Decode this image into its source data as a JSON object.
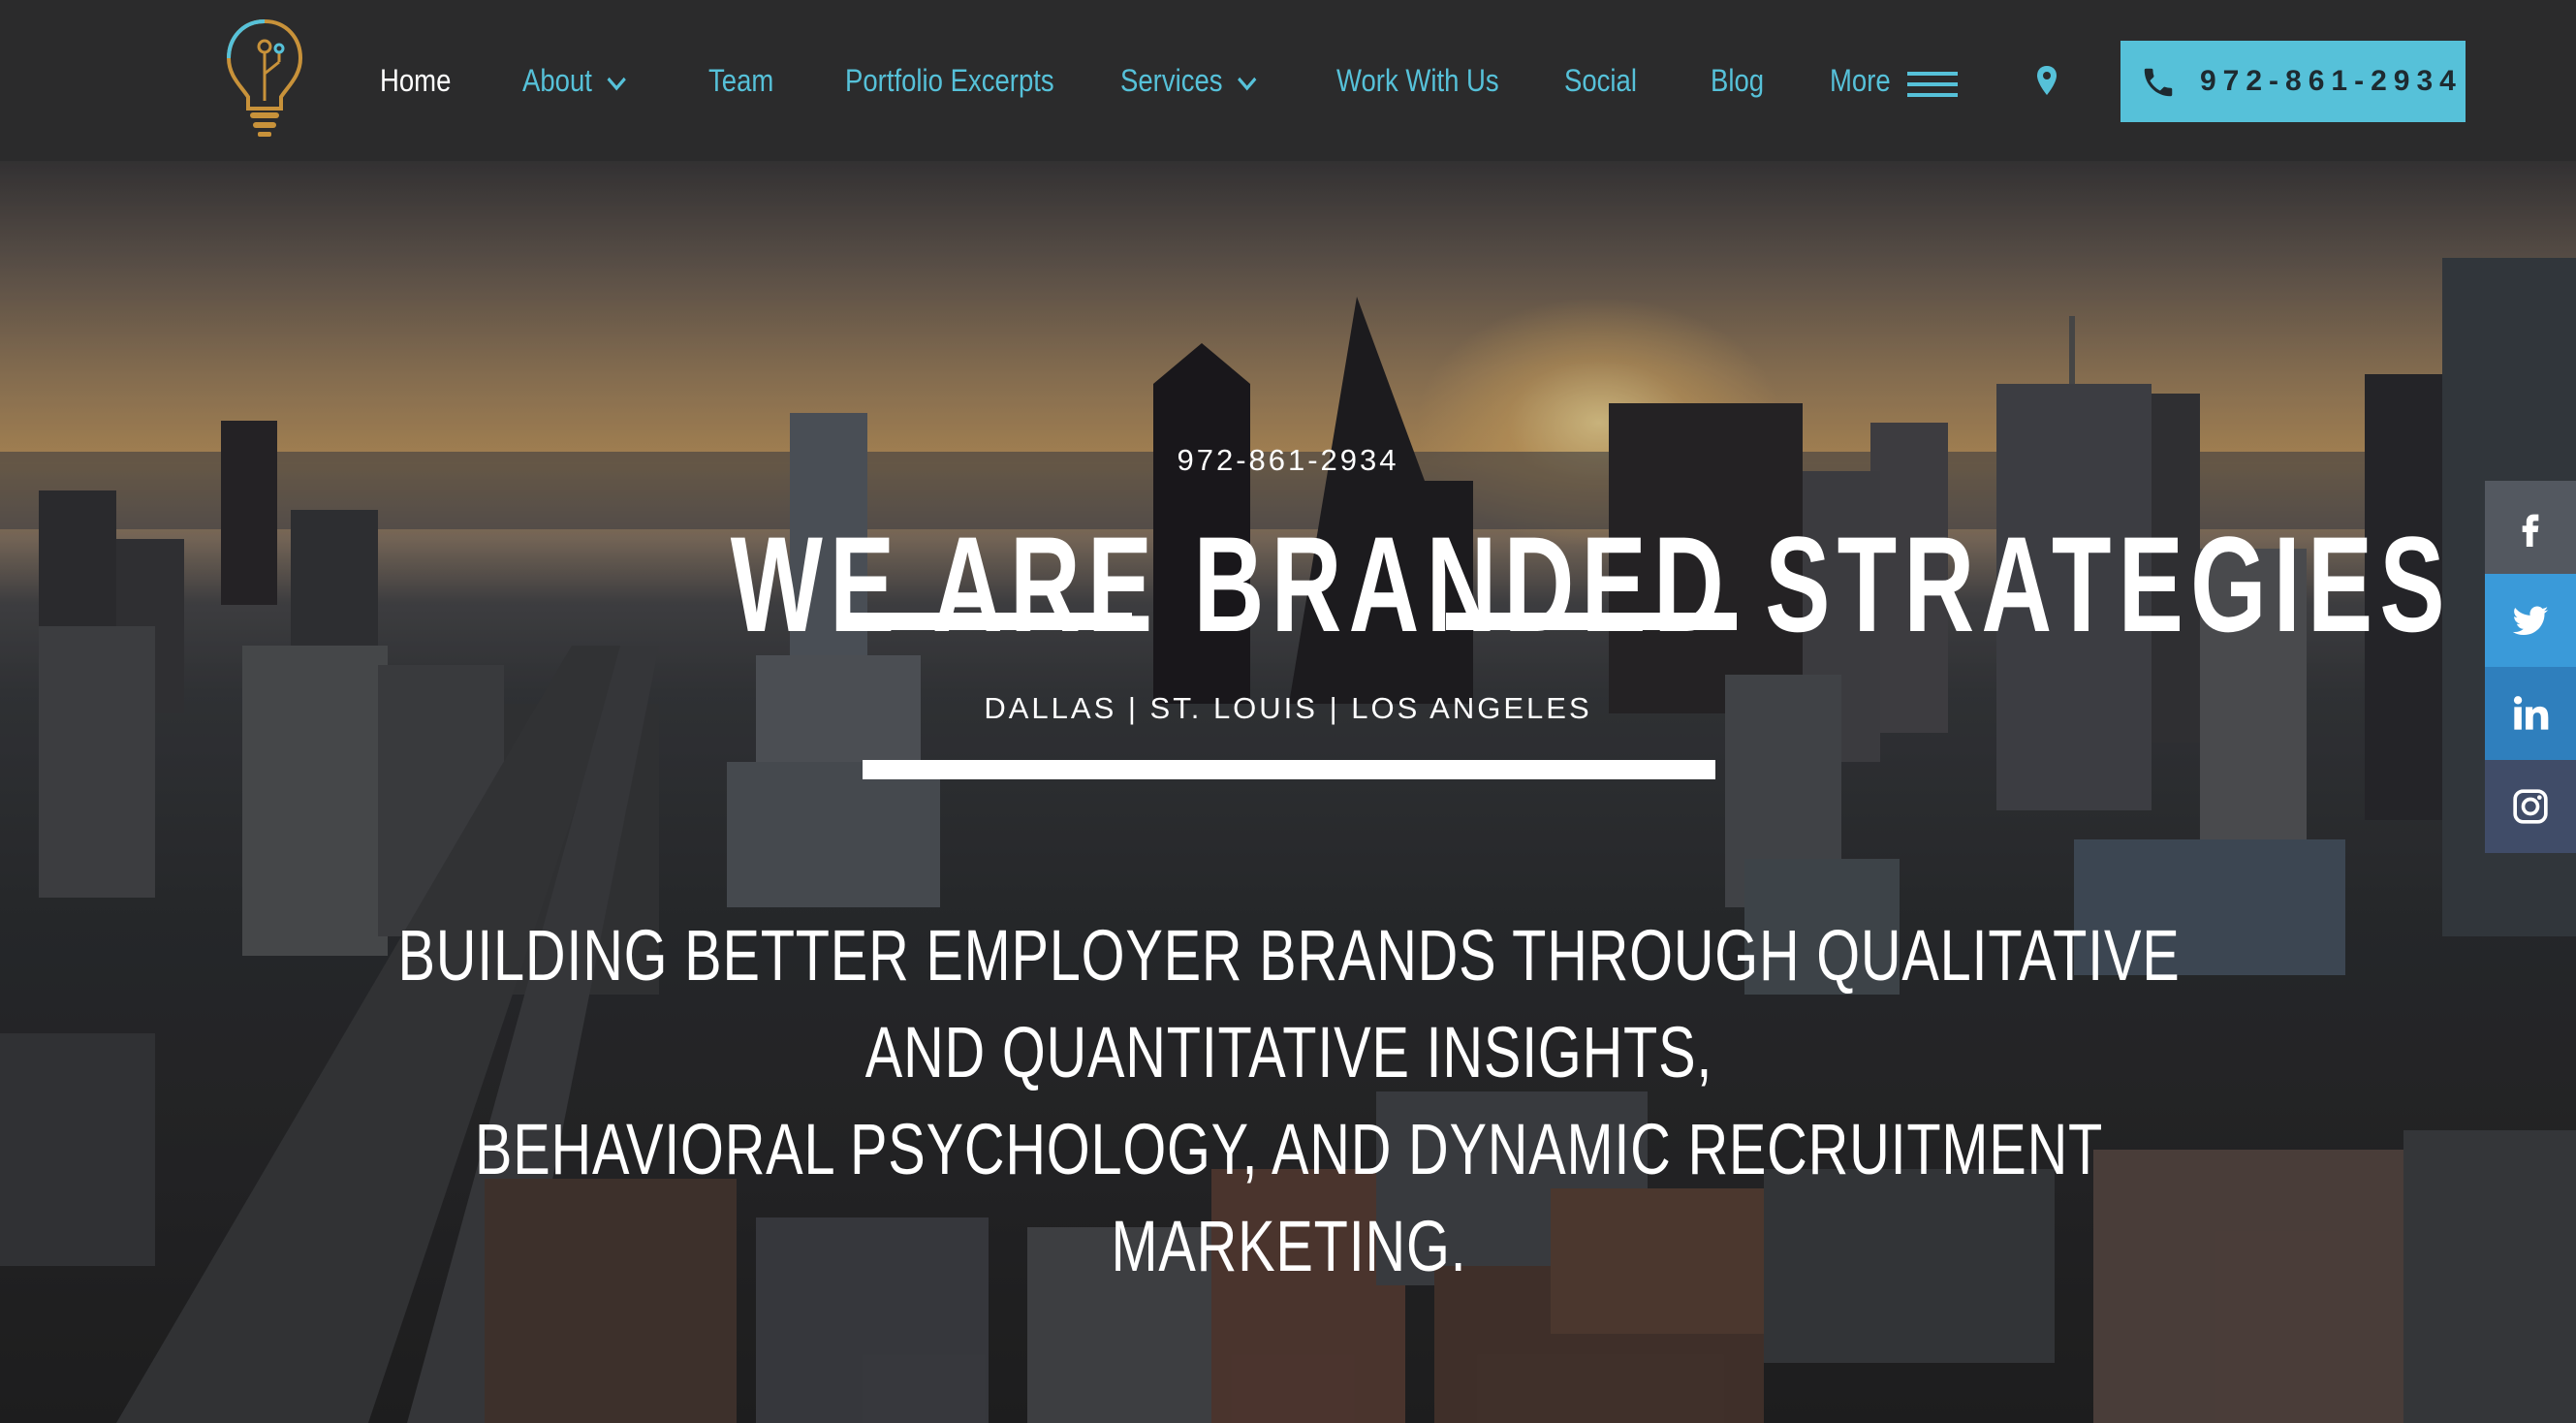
{
  "nav": {
    "items": [
      {
        "label": "Home",
        "active": true
      },
      {
        "label": "About",
        "dropdown": true
      },
      {
        "label": "Team"
      },
      {
        "label": "Portfolio Excerpts"
      },
      {
        "label": "Services",
        "dropdown": true
      },
      {
        "label": "Work With Us"
      },
      {
        "label": "Social"
      },
      {
        "label": "Blog"
      },
      {
        "label": "More"
      }
    ],
    "call_button_label": "972-861-2934",
    "icons": {
      "logo": "lightbulb-circuit-logo",
      "more": "hamburger-menu-icon",
      "location": "map-pin-icon",
      "phone": "phone-icon"
    }
  },
  "hero": {
    "phone": "972-861-2934",
    "title": "WE ARE BRANDED STRATEGIES",
    "cities": "DALLAS | ST. LOUIS | LOS ANGELES",
    "tagline_line1": "BUILDING BETTER EMPLOYER BRANDS THROUGH QUALITATIVE AND QUANTITATIVE INSIGHTS,",
    "tagline_line2": "BEHAVIORAL PSYCHOLOGY, AND DYNAMIC RECRUITMENT MARKETING."
  },
  "social": [
    "facebook-icon",
    "twitter-icon",
    "linkedin-icon",
    "instagram-icon"
  ],
  "colors": {
    "accent": "#56c1d9",
    "nav_bg": "#2b2b2c",
    "logo_gold": "#c8923a",
    "facebook_bg": "#535860",
    "twitter_bg": "#3a9ad9",
    "linkedin_bg": "#2f7fbd",
    "instagram_bg": "#404c68"
  }
}
